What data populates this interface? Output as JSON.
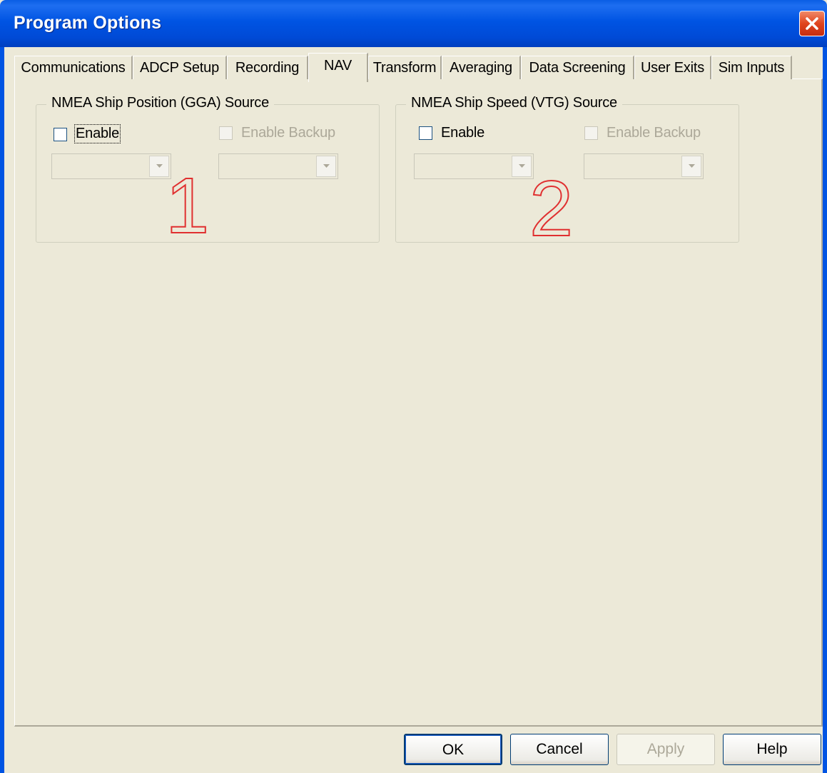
{
  "window": {
    "title": "Program Options"
  },
  "tabs": [
    {
      "label": "Communications"
    },
    {
      "label": "ADCP Setup"
    },
    {
      "label": "Recording"
    },
    {
      "label": "NAV"
    },
    {
      "label": "Transform"
    },
    {
      "label": "Averaging"
    },
    {
      "label": "Data Screening"
    },
    {
      "label": "User Exits"
    },
    {
      "label": "Sim Inputs"
    }
  ],
  "active_tab": "NAV",
  "gga": {
    "title": "NMEA Ship Position (GGA) Source",
    "enable_label": "Enable",
    "enable_checked": false,
    "backup_label": "Enable Backup",
    "backup_checked": false,
    "annotation": "1"
  },
  "vtg": {
    "title": "NMEA Ship Speed (VTG) Source",
    "enable_label": "Enable",
    "enable_checked": false,
    "backup_label": "Enable Backup",
    "backup_checked": false,
    "annotation": "2"
  },
  "buttons": {
    "ok": "OK",
    "cancel": "Cancel",
    "apply": "Apply",
    "help": "Help"
  },
  "colors": {
    "titlebar": "#0054e3",
    "dialog_bg": "#ece9d8",
    "annotation": "#e03030",
    "disabled_text": "#aca899"
  }
}
